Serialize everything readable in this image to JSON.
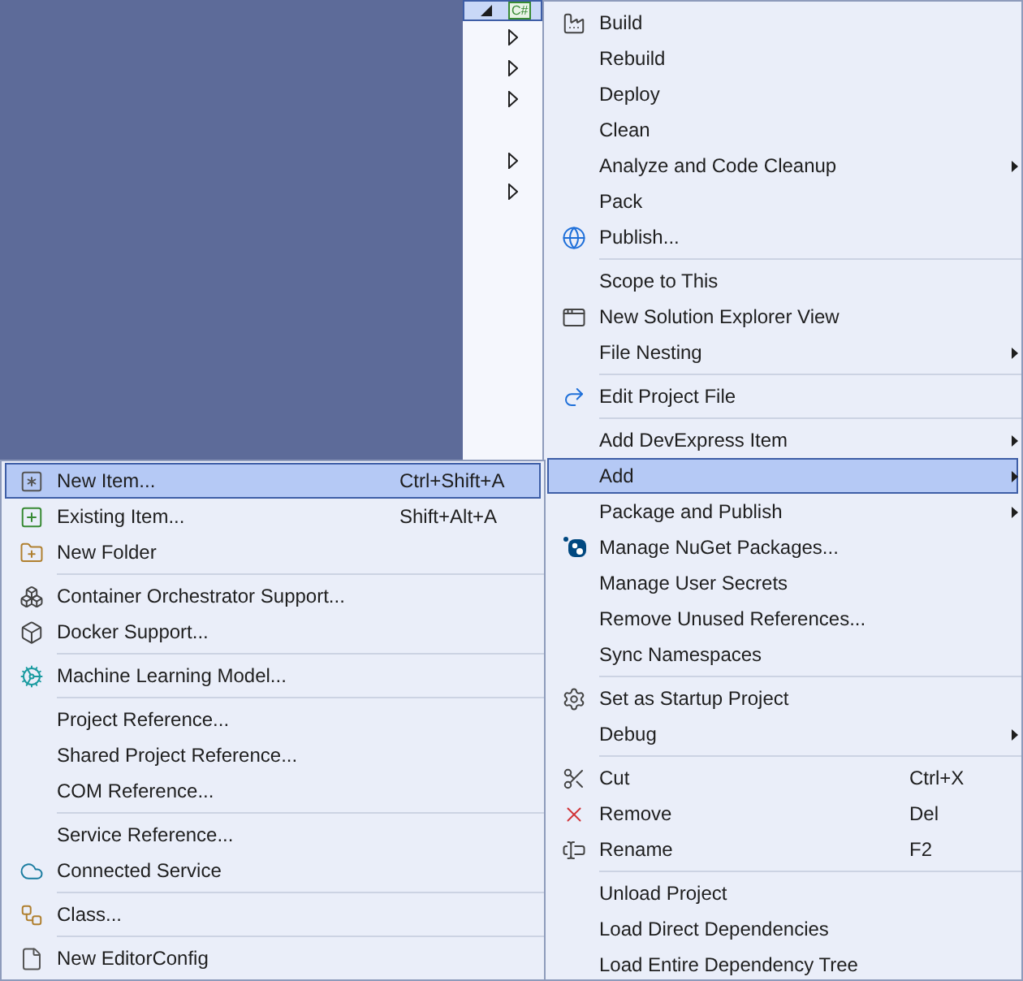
{
  "tree": {
    "root": {
      "expanded": true,
      "selected": true,
      "icon_text": "C#"
    },
    "children": [
      {
        "kind": "node",
        "expanded": false
      },
      {
        "kind": "node",
        "expanded": false
      },
      {
        "kind": "node",
        "expanded": false
      },
      {
        "kind": "leaf"
      },
      {
        "kind": "node",
        "expanded": false
      },
      {
        "kind": "node",
        "expanded": false
      }
    ]
  },
  "context_menu": {
    "items": [
      {
        "kind": "item",
        "label": "Build",
        "selected": false,
        "submenu": false
      },
      {
        "kind": "item",
        "label": "Rebuild",
        "selected": false,
        "submenu": false
      },
      {
        "kind": "item",
        "label": "Deploy",
        "selected": false,
        "submenu": false
      },
      {
        "kind": "item",
        "label": "Clean",
        "selected": false,
        "submenu": false
      },
      {
        "kind": "item",
        "label": "Analyze and Code Cleanup",
        "selected": false,
        "submenu": true
      },
      {
        "kind": "item",
        "label": "Pack",
        "selected": false,
        "submenu": false
      },
      {
        "kind": "item",
        "label": "Publish...",
        "selected": false,
        "submenu": false
      },
      {
        "kind": "separator"
      },
      {
        "kind": "item",
        "label": "Scope to This",
        "selected": false,
        "submenu": false
      },
      {
        "kind": "item",
        "label": "New Solution Explorer View",
        "selected": false,
        "submenu": false
      },
      {
        "kind": "item",
        "label": "File Nesting",
        "selected": false,
        "submenu": true
      },
      {
        "kind": "separator"
      },
      {
        "kind": "item",
        "label": "Edit Project File",
        "selected": false,
        "submenu": false
      },
      {
        "kind": "separator"
      },
      {
        "kind": "item",
        "label": "Add DevExpress Item",
        "selected": false,
        "submenu": true
      },
      {
        "kind": "item",
        "label": "Add",
        "selected": true,
        "submenu": true
      },
      {
        "kind": "item",
        "label": "Package and Publish",
        "selected": false,
        "submenu": true
      },
      {
        "kind": "item",
        "label": "Manage NuGet Packages...",
        "selected": false,
        "submenu": false
      },
      {
        "kind": "item",
        "label": "Manage User Secrets",
        "selected": false,
        "submenu": false
      },
      {
        "kind": "item",
        "label": "Remove Unused References...",
        "selected": false,
        "submenu": false
      },
      {
        "kind": "item",
        "label": "Sync Namespaces",
        "selected": false,
        "submenu": false
      },
      {
        "kind": "separator"
      },
      {
        "kind": "item",
        "label": "Set as Startup Project",
        "selected": false,
        "submenu": false
      },
      {
        "kind": "item",
        "label": "Debug",
        "selected": false,
        "submenu": true
      },
      {
        "kind": "separator"
      },
      {
        "kind": "item",
        "label": "Cut",
        "shortcut": "Ctrl+X",
        "selected": false,
        "submenu": false
      },
      {
        "kind": "item",
        "label": "Remove",
        "shortcut": "Del",
        "selected": false,
        "submenu": false
      },
      {
        "kind": "item",
        "label": "Rename",
        "shortcut": "F2",
        "selected": false,
        "submenu": false
      },
      {
        "kind": "separator"
      },
      {
        "kind": "item",
        "label": "Unload Project",
        "selected": false,
        "submenu": false
      },
      {
        "kind": "item",
        "label": "Load Direct Dependencies",
        "selected": false,
        "submenu": false
      },
      {
        "kind": "item",
        "label": "Load Entire Dependency Tree",
        "selected": false,
        "submenu": false
      }
    ]
  },
  "add_submenu": {
    "items": [
      {
        "kind": "item",
        "label": "New Item...",
        "shortcut": "Ctrl+Shift+A",
        "selected": true
      },
      {
        "kind": "item",
        "label": "Existing Item...",
        "shortcut": "Shift+Alt+A",
        "selected": false
      },
      {
        "kind": "item",
        "label": "New Folder",
        "selected": false
      },
      {
        "kind": "separator"
      },
      {
        "kind": "item",
        "label": "Container Orchestrator Support...",
        "selected": false
      },
      {
        "kind": "item",
        "label": "Docker Support...",
        "selected": false
      },
      {
        "kind": "separator"
      },
      {
        "kind": "item",
        "label": "Machine Learning Model...",
        "selected": false
      },
      {
        "kind": "separator"
      },
      {
        "kind": "item",
        "label": "Project Reference...",
        "selected": false
      },
      {
        "kind": "item",
        "label": "Shared Project Reference...",
        "selected": false
      },
      {
        "kind": "item",
        "label": "COM Reference...",
        "selected": false
      },
      {
        "kind": "separator"
      },
      {
        "kind": "item",
        "label": "Service Reference...",
        "selected": false
      },
      {
        "kind": "item",
        "label": "Connected Service",
        "selected": false
      },
      {
        "kind": "separator"
      },
      {
        "kind": "item",
        "label": "Class...",
        "selected": false
      },
      {
        "kind": "separator"
      },
      {
        "kind": "item",
        "label": "New EditorConfig",
        "selected": false
      }
    ]
  }
}
